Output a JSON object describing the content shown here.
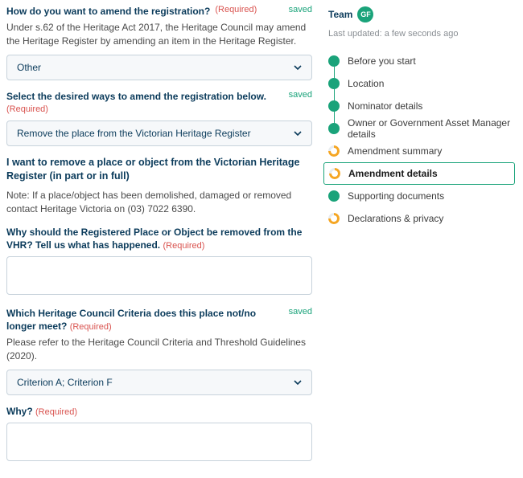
{
  "main": {
    "q1": {
      "label": "How do you want to amend the registration?",
      "required": "(Required)",
      "saved": "saved",
      "help": "Under s.62 of the Heritage Act 2017, the Heritage Council may amend the Heritage Register by amending an item in the Heritage Register.",
      "value": "Other"
    },
    "q2": {
      "label": "Select the desired ways to amend the registration below.",
      "required": "(Required)",
      "saved": "saved",
      "value": "Remove the place from the Victorian Heritage Register"
    },
    "section": {
      "heading": "I want to remove a place or object from the Victorian Heritage Register (in part or in full)",
      "note": "Note: If a place/object has been demolished, damaged or removed contact Heritage Victoria on (03) 7022 6390."
    },
    "q3": {
      "label": "Why should the Registered Place or Object be removed from the VHR? Tell us what has happened.",
      "required": "(Required)",
      "value": ""
    },
    "q4": {
      "label": "Which Heritage Council Criteria does this place not/no longer meet?",
      "required": "(Required)",
      "saved": "saved",
      "help": "Please refer to the Heritage Council Criteria and Threshold Guidelines (2020).",
      "value": "Criterion A; Criterion F"
    },
    "q5": {
      "label": "Why?",
      "required": "(Required)",
      "value": ""
    }
  },
  "sidebar": {
    "team_label": "Team",
    "avatar_initials": "GF",
    "last_updated": "Last updated: a few seconds ago",
    "steps": [
      {
        "label": "Before you start",
        "state": "done"
      },
      {
        "label": "Location",
        "state": "done"
      },
      {
        "label": "Nominator details",
        "state": "done"
      },
      {
        "label": "Owner or Government Asset Manager details",
        "state": "done"
      },
      {
        "label": "Amendment summary",
        "state": "partial"
      },
      {
        "label": "Amendment details",
        "state": "partial",
        "active": true
      },
      {
        "label": "Supporting documents",
        "state": "done"
      },
      {
        "label": "Declarations & privacy",
        "state": "partial"
      }
    ]
  }
}
